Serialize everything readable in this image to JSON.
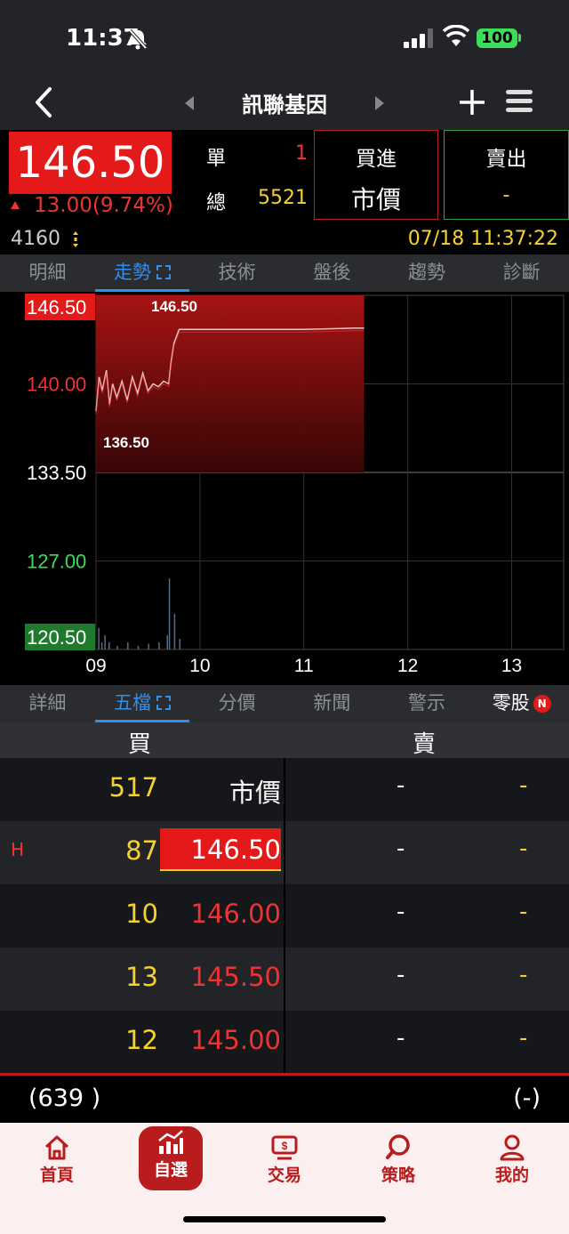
{
  "status": {
    "time": "11:37",
    "battery": "100"
  },
  "nav": {
    "title": "訊聯基因"
  },
  "quote": {
    "price": "146.50",
    "change": "13.00(9.74%)",
    "dan_label": "單",
    "dan_value": "1",
    "zong_label": "總",
    "zong_value": "5521",
    "buy_label": "買進",
    "buy_value": "市價",
    "sell_label": "賣出",
    "sell_value": "-",
    "volume": "4160",
    "datetime": "07/18 11:37:22"
  },
  "tabs_top": [
    "明細",
    "走勢",
    "技術",
    "盤後",
    "趨勢",
    "診斷"
  ],
  "tabs_book": [
    "詳細",
    "五檔",
    "分價",
    "新聞",
    "警示",
    "零股"
  ],
  "book_badge": "N",
  "chart_data": {
    "type": "line",
    "y_labels": [
      "146.50",
      "140.00",
      "133.50",
      "127.00",
      "120.50"
    ],
    "x_labels": [
      "09",
      "10",
      "11",
      "12",
      "13"
    ],
    "high_label": "146.50",
    "low_label": "136.50",
    "ylim": [
      120.5,
      146.5
    ],
    "reference": 133.5,
    "x": [
      9.0,
      9.03,
      9.06,
      9.1,
      9.13,
      9.16,
      9.2,
      9.25,
      9.3,
      9.35,
      9.4,
      9.45,
      9.5,
      9.55,
      9.6,
      9.65,
      9.7,
      9.72,
      9.75,
      9.8,
      10.0,
      10.5,
      11.0,
      11.5,
      11.58
    ],
    "values": [
      138.0,
      140.5,
      139.5,
      141.0,
      138.5,
      140.0,
      139.0,
      140.2,
      138.8,
      140.5,
      139.3,
      140.8,
      139.5,
      140.0,
      139.8,
      140.2,
      140.0,
      141.5,
      143.0,
      144.0,
      144.0,
      144.0,
      144.0,
      144.1,
      144.1
    ],
    "volume_x": [
      9.02,
      9.05,
      9.08,
      9.12,
      9.2,
      9.3,
      9.4,
      9.5,
      9.6,
      9.68,
      9.7,
      9.75,
      9.8
    ],
    "volume_h": [
      0.3,
      0.1,
      0.2,
      0.1,
      0.05,
      0.1,
      0.05,
      0.08,
      0.1,
      0.2,
      1.0,
      0.5,
      0.15
    ],
    "grid": true
  },
  "book": {
    "buy_header": "買",
    "sell_header": "賣",
    "rows": [
      {
        "marker": "",
        "bid_qty": "517",
        "bid_price": "市價",
        "ask_price": "-",
        "ask_qty": "-"
      },
      {
        "marker": "H",
        "bid_qty": "87",
        "bid_price": "146.50",
        "ask_price": "-",
        "ask_qty": "-"
      },
      {
        "marker": "",
        "bid_qty": "10",
        "bid_price": "146.00",
        "ask_price": "-",
        "ask_qty": "-"
      },
      {
        "marker": "",
        "bid_qty": "13",
        "bid_price": "145.50",
        "ask_price": "-",
        "ask_qty": "-"
      },
      {
        "marker": "",
        "bid_qty": "12",
        "bid_price": "145.00",
        "ask_price": "-",
        "ask_qty": "-"
      }
    ],
    "bid_total": "(639 )",
    "ask_total": "(-)"
  },
  "bottom_nav": [
    "首頁",
    "自選",
    "交易",
    "策略",
    "我的"
  ],
  "colors": {
    "up": "#e41a1a",
    "down": "#2fa23f",
    "accent": "#2f8fea",
    "brand": "#b81c1c"
  }
}
